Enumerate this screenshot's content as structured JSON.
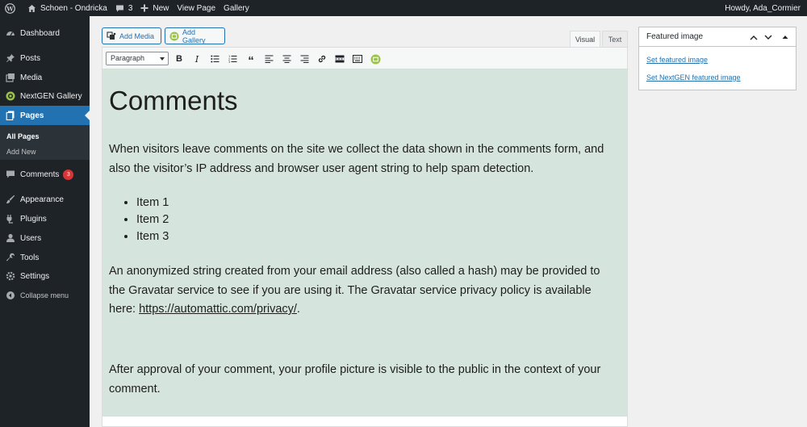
{
  "adminbar": {
    "site_name": "Schoen - Ondricka",
    "comments_count": "3",
    "new_label": "New",
    "view_page_label": "View Page",
    "gallery_label": "Gallery",
    "howdy": "Howdy, Ada_Cormier"
  },
  "sidebar": {
    "dashboard": "Dashboard",
    "posts": "Posts",
    "media": "Media",
    "nextgen": "NextGEN Gallery",
    "pages": "Pages",
    "all_pages": "All Pages",
    "add_new": "Add New",
    "comments": "Comments",
    "comments_badge": "3",
    "appearance": "Appearance",
    "plugins": "Plugins",
    "users": "Users",
    "tools": "Tools",
    "settings": "Settings",
    "collapse": "Collapse menu"
  },
  "editor": {
    "add_media": "Add Media",
    "add_gallery": "Add Gallery",
    "tab_visual": "Visual",
    "tab_text": "Text",
    "format_select": "Paragraph",
    "heading": "Comments",
    "para1": "When visitors leave comments on the site we collect the data shown in the comments form, and also the visitor’s IP address and browser user agent string to help spam detection.",
    "list": [
      "Item 1",
      "Item 2",
      "Item 3"
    ],
    "para2_text": "An anonymized string created from your email address (also called a hash) may be provided to the Gravatar service to see if you are using it. The Gravatar service privacy policy is available here: ",
    "para2_link": "https://automattic.com/privacy/",
    "para2_end": ".",
    "para3": "After approval of your comment, your profile picture is visible to the public in the context of your comment."
  },
  "featured_image": {
    "title": "Featured image",
    "set_featured": "Set featured image",
    "set_nextgen": "Set NextGEN featured image"
  },
  "colors": {
    "admin_dark": "#1d2327",
    "accent": "#2271b1",
    "editor_bg": "#d6e4de",
    "badge": "#d63638"
  }
}
